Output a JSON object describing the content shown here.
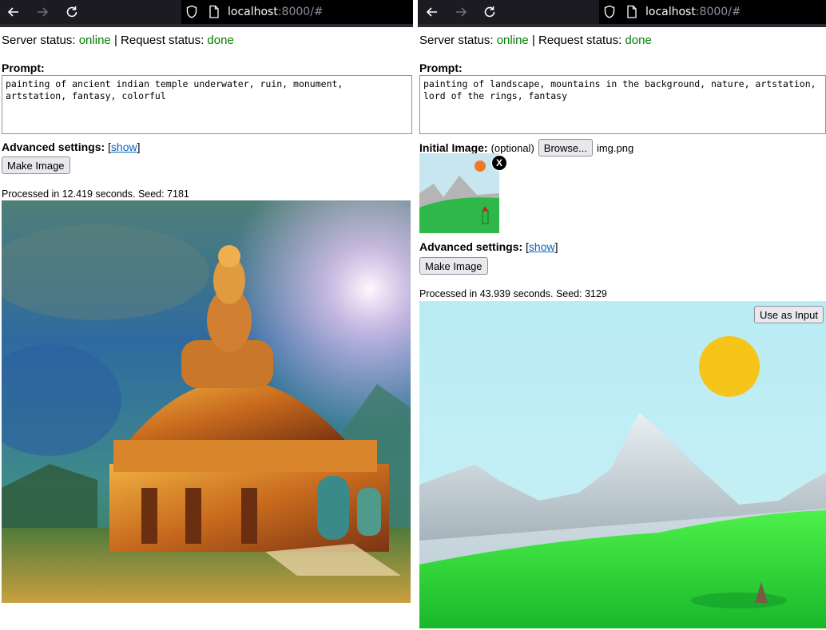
{
  "address": {
    "host": "localhost",
    "port": ":8000/#"
  },
  "left": {
    "server_status_label": "Server status:",
    "server_status": "online",
    "separator": "|",
    "request_status_label": "Request status:",
    "request_status": "done",
    "prompt_label": "Prompt:",
    "prompt_text": "painting of ancient indian temple underwater, ruin, monument, artstation, fantasy, colorful",
    "advanced_label": "Advanced settings:",
    "advanced_link": "show",
    "make_image": "Make Image",
    "processed": "Processed in 12.419 seconds. Seed: 7181"
  },
  "right": {
    "server_status_label": "Server status:",
    "server_status": "online",
    "separator": "|",
    "request_status_label": "Request status:",
    "request_status": "done",
    "prompt_label": "Prompt:",
    "prompt_text": "painting of landscape, mountains in the background, nature, artstation, lord of the rings, fantasy",
    "initial_image_label": "Initial Image:",
    "initial_image_optional": "(optional)",
    "browse_button": "Browse...",
    "file_name": "img.png",
    "remove_image": "X",
    "advanced_label": "Advanced settings:",
    "advanced_link": "show",
    "make_image": "Make Image",
    "processed": "Processed in 43.939 seconds. Seed: 3129",
    "use_as_input": "Use as Input"
  },
  "colors": {
    "status_ok": "#008000",
    "link": "#0b62c4",
    "toolbar_bg": "#1c1b22",
    "button_bg": "#e9e9ed"
  },
  "icons": [
    "back-arrow-icon",
    "forward-arrow-icon",
    "reload-icon",
    "shield-icon",
    "page-icon",
    "close-icon"
  ]
}
